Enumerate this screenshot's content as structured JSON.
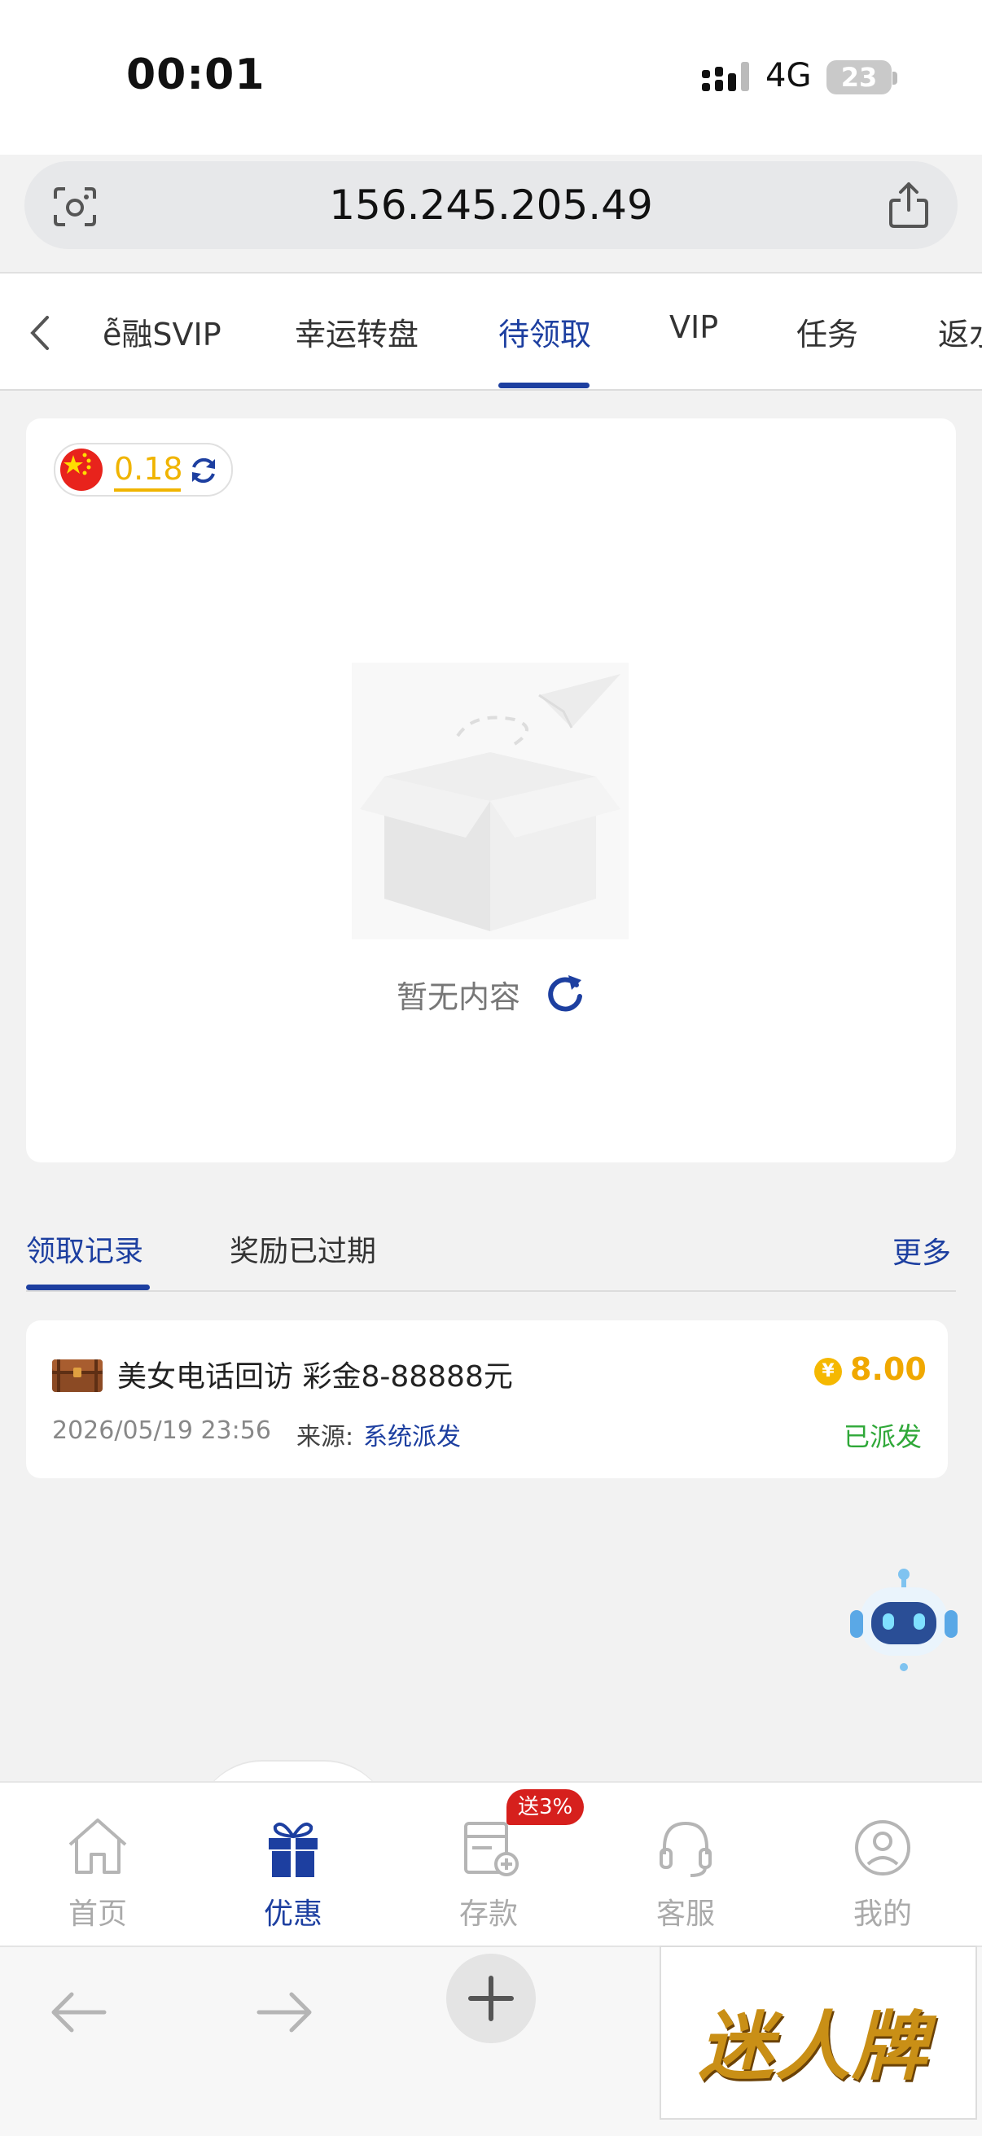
{
  "status_bar": {
    "time": "00:01",
    "network": "4G",
    "battery": "23"
  },
  "address_bar": {
    "url": "156.245.205.49"
  },
  "tabs": [
    {
      "label": "金融SVIP",
      "visible_label": "ễ融SVIP"
    },
    {
      "label": "幸运转盘"
    },
    {
      "label": "待领取",
      "active": true
    },
    {
      "label": "VIP"
    },
    {
      "label": "任务"
    },
    {
      "label": "返水"
    }
  ],
  "balance": {
    "value": "0.18"
  },
  "empty_state": {
    "text": "暂无内容"
  },
  "records": {
    "tab_active": "领取记录",
    "tab_expired": "奖励已过期",
    "more": "更多",
    "items": [
      {
        "title": "美女电话回访 彩金8-88888元",
        "amount": "8.00",
        "coin_symbol": "¥",
        "date": "2026/05/19 23:56",
        "source_label": "来源:",
        "source": "系统派发",
        "status": "已派发"
      }
    ]
  },
  "bottom_nav": {
    "items": [
      {
        "label": "首页",
        "icon": "home-icon"
      },
      {
        "label": "优惠",
        "icon": "gift-icon",
        "active": true
      },
      {
        "label": "存款",
        "icon": "deposit-icon"
      },
      {
        "label": "客服",
        "icon": "headset-icon"
      },
      {
        "label": "我的",
        "icon": "user-icon"
      }
    ],
    "deposit_badge": "送3%"
  },
  "ad": {
    "text": "迷人牌"
  },
  "colors": {
    "brand": "#1d3fa0",
    "gold": "#f0b400",
    "green": "#2fa838",
    "red": "#d6201d"
  }
}
